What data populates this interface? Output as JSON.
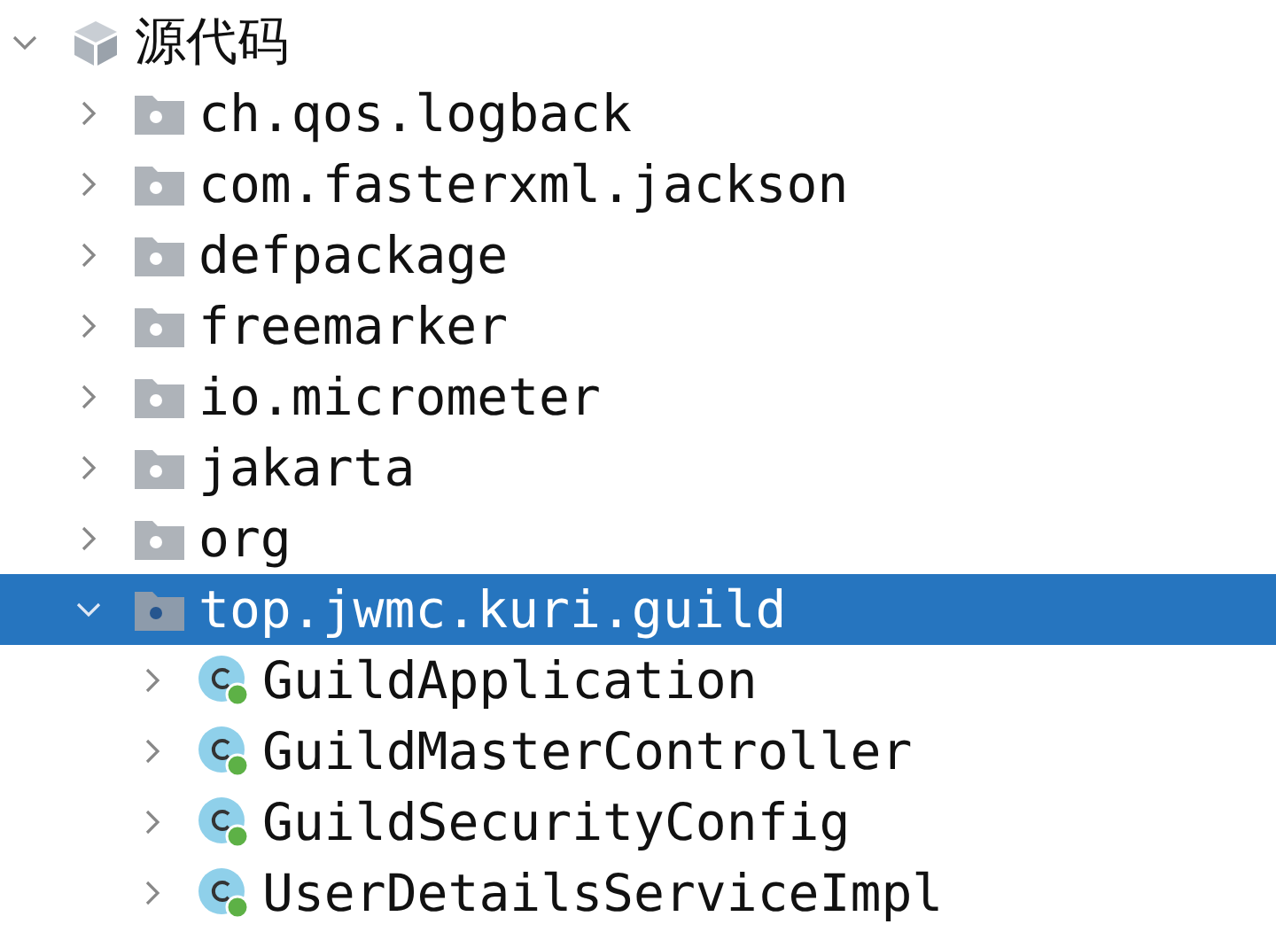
{
  "tree": [
    {
      "label": "源代码",
      "kind": "module",
      "expanded": true,
      "selected": false,
      "children": [
        {
          "label": "ch.qos.logback",
          "kind": "package",
          "expanded": false,
          "selected": false
        },
        {
          "label": "com.fasterxml.jackson",
          "kind": "package",
          "expanded": false,
          "selected": false
        },
        {
          "label": "defpackage",
          "kind": "package",
          "expanded": false,
          "selected": false
        },
        {
          "label": "freemarker",
          "kind": "package",
          "expanded": false,
          "selected": false
        },
        {
          "label": "io.micrometer",
          "kind": "package",
          "expanded": false,
          "selected": false
        },
        {
          "label": "jakarta",
          "kind": "package",
          "expanded": false,
          "selected": false
        },
        {
          "label": "org",
          "kind": "package",
          "expanded": false,
          "selected": false
        },
        {
          "label": "top.jwmc.kuri.guild",
          "kind": "package",
          "expanded": true,
          "selected": true,
          "children": [
            {
              "label": "GuildApplication",
              "kind": "class",
              "expanded": false,
              "selected": false
            },
            {
              "label": "GuildMasterController",
              "kind": "class",
              "expanded": false,
              "selected": false
            },
            {
              "label": "GuildSecurityConfig",
              "kind": "class",
              "expanded": false,
              "selected": false
            },
            {
              "label": "UserDetailsServiceImpl",
              "kind": "class",
              "expanded": false,
              "selected": false
            }
          ]
        }
      ]
    }
  ]
}
